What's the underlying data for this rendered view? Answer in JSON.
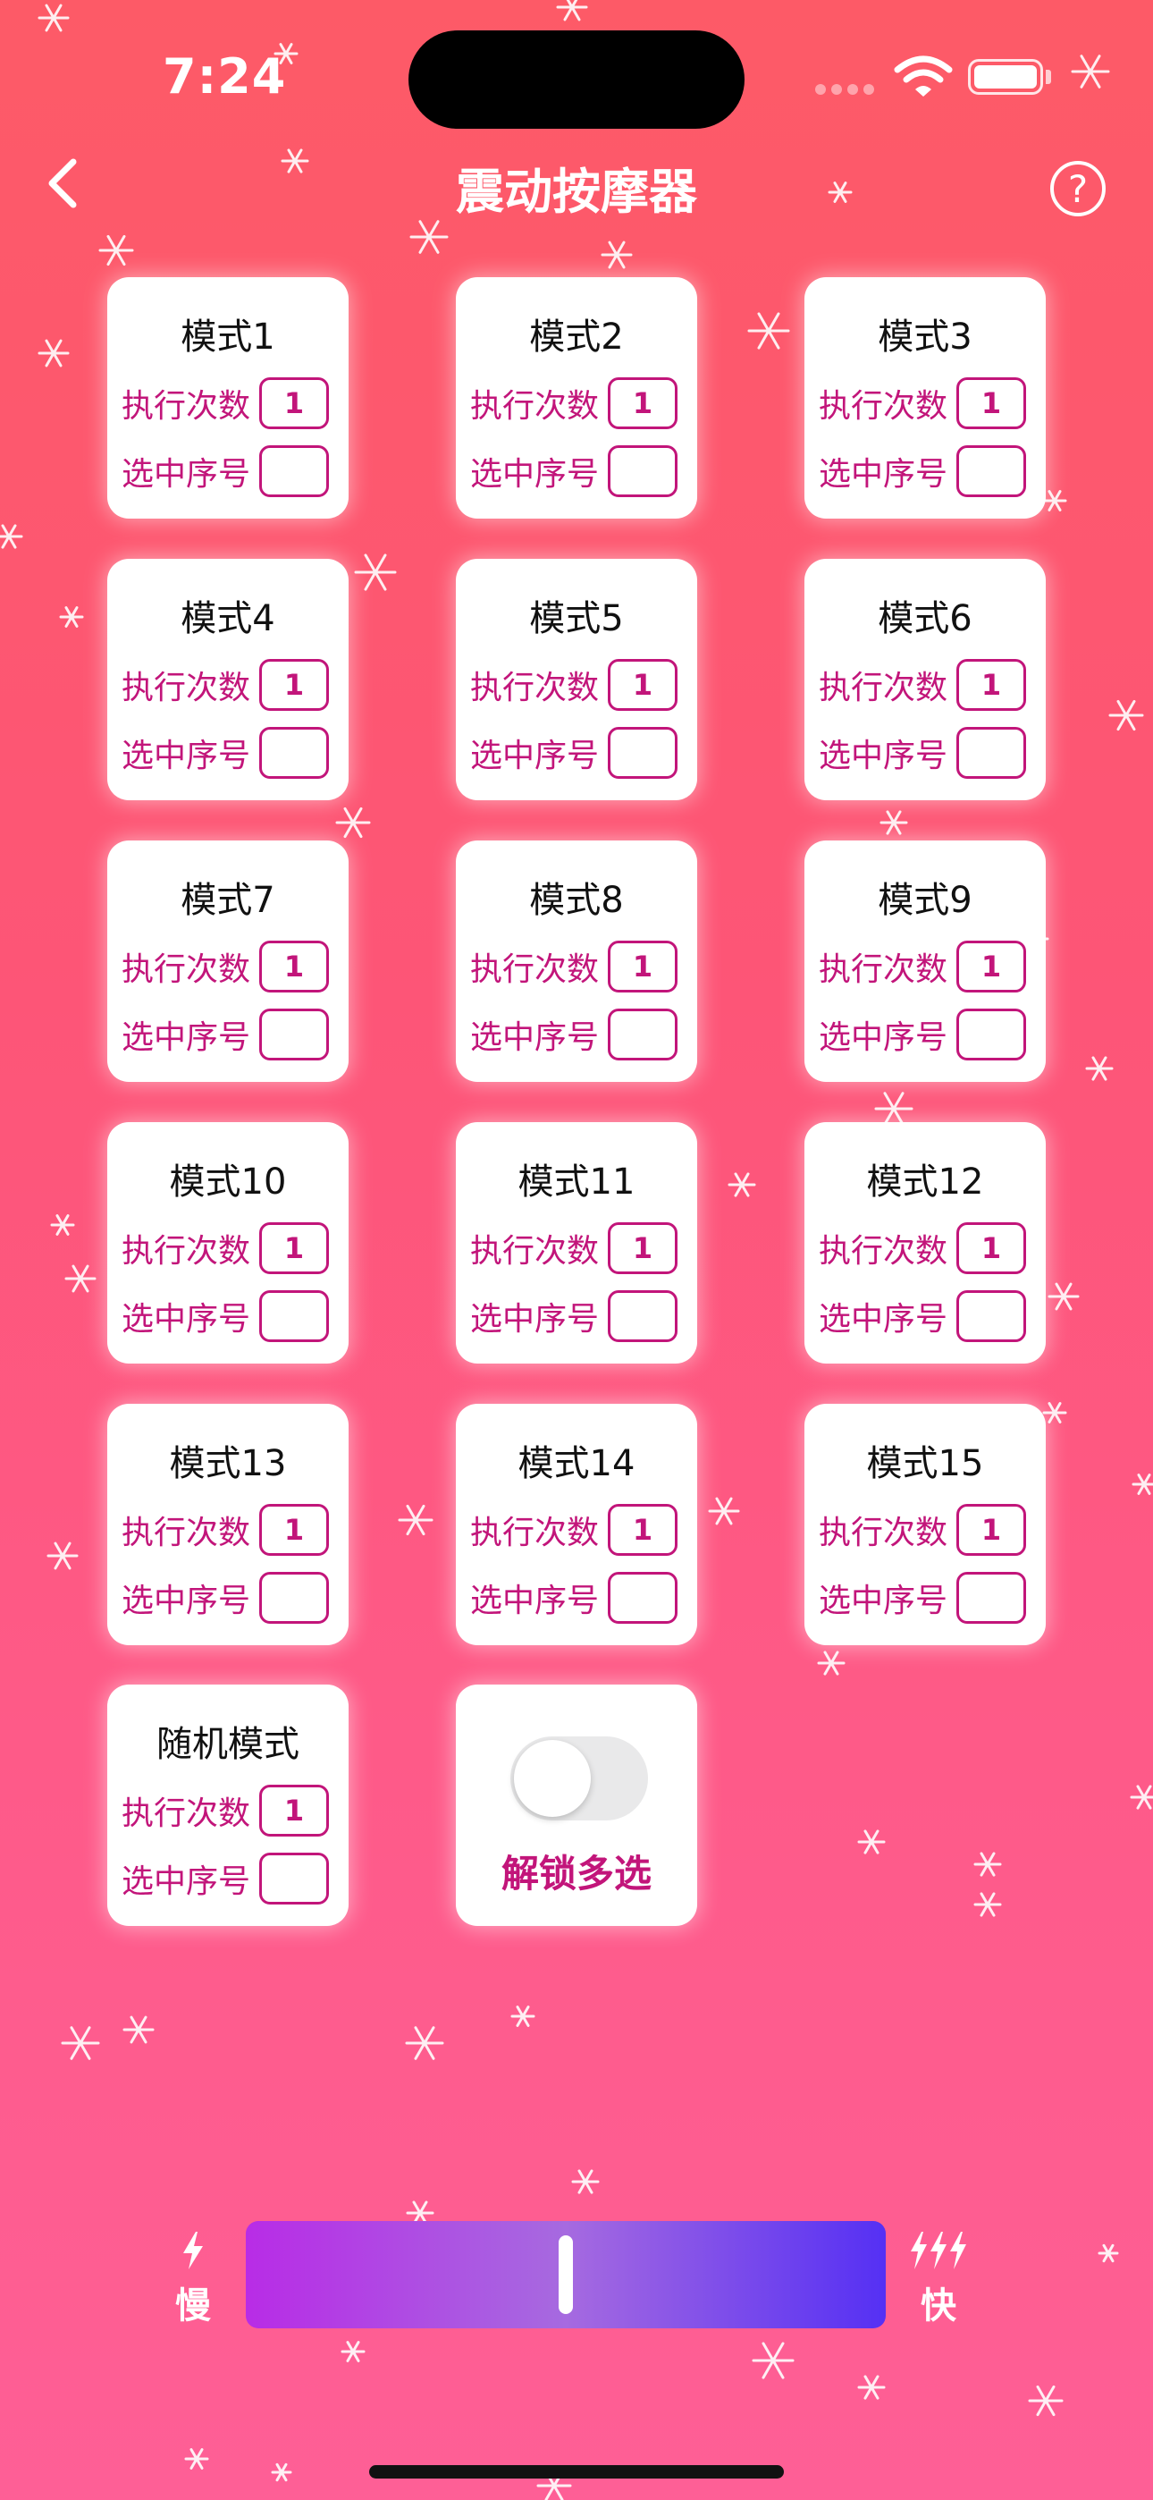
{
  "status_bar": {
    "time": "7:24"
  },
  "header": {
    "title": "震动按摩器",
    "help_icon_label": "?"
  },
  "modes": [
    {
      "title": "模式1",
      "count_label": "执行次数",
      "count": "1",
      "select_label": "选中序号",
      "selected": ""
    },
    {
      "title": "模式2",
      "count_label": "执行次数",
      "count": "1",
      "select_label": "选中序号",
      "selected": ""
    },
    {
      "title": "模式3",
      "count_label": "执行次数",
      "count": "1",
      "select_label": "选中序号",
      "selected": ""
    },
    {
      "title": "模式4",
      "count_label": "执行次数",
      "count": "1",
      "select_label": "选中序号",
      "selected": ""
    },
    {
      "title": "模式5",
      "count_label": "执行次数",
      "count": "1",
      "select_label": "选中序号",
      "selected": ""
    },
    {
      "title": "模式6",
      "count_label": "执行次数",
      "count": "1",
      "select_label": "选中序号",
      "selected": ""
    },
    {
      "title": "模式7",
      "count_label": "执行次数",
      "count": "1",
      "select_label": "选中序号",
      "selected": ""
    },
    {
      "title": "模式8",
      "count_label": "执行次数",
      "count": "1",
      "select_label": "选中序号",
      "selected": ""
    },
    {
      "title": "模式9",
      "count_label": "执行次数",
      "count": "1",
      "select_label": "选中序号",
      "selected": ""
    },
    {
      "title": "模式10",
      "count_label": "执行次数",
      "count": "1",
      "select_label": "选中序号",
      "selected": ""
    },
    {
      "title": "模式11",
      "count_label": "执行次数",
      "count": "1",
      "select_label": "选中序号",
      "selected": ""
    },
    {
      "title": "模式12",
      "count_label": "执行次数",
      "count": "1",
      "select_label": "选中序号",
      "selected": ""
    },
    {
      "title": "模式13",
      "count_label": "执行次数",
      "count": "1",
      "select_label": "选中序号",
      "selected": ""
    },
    {
      "title": "模式14",
      "count_label": "执行次数",
      "count": "1",
      "select_label": "选中序号",
      "selected": ""
    },
    {
      "title": "模式15",
      "count_label": "执行次数",
      "count": "1",
      "select_label": "选中序号",
      "selected": ""
    },
    {
      "title": "随机模式",
      "count_label": "执行次数",
      "count": "1",
      "select_label": "选中序号",
      "selected": ""
    }
  ],
  "multi_select": {
    "label": "解锁多选",
    "enabled": false
  },
  "speed": {
    "slow_label": "慢",
    "fast_label": "快",
    "value": 0.5
  },
  "colors": {
    "accent": "#c2157a",
    "background_top": "#fd5a67",
    "background_bottom": "#fe5f96",
    "slider_start": "#b82ce6",
    "slider_end": "#5530f4"
  }
}
